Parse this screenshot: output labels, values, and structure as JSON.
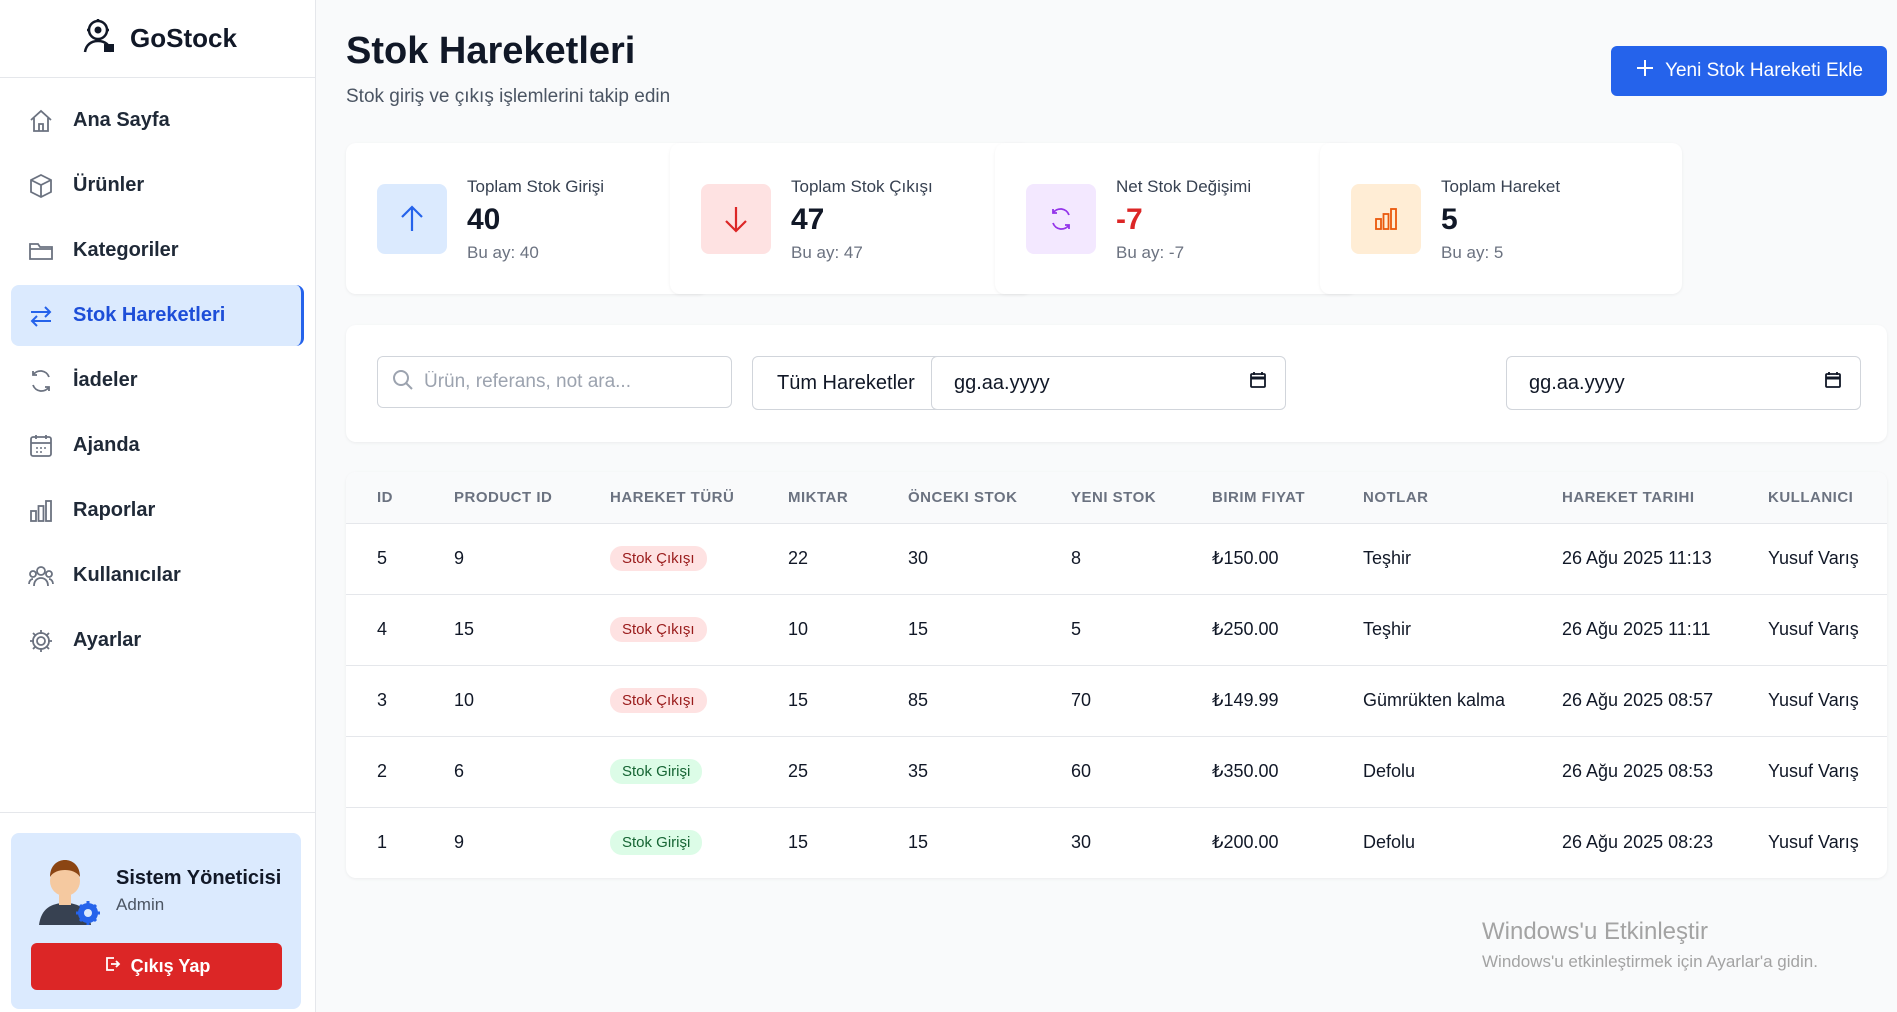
{
  "brand": {
    "name": "GoStock"
  },
  "sidebar": {
    "items": [
      {
        "label": "Ana Sayfa",
        "icon": "home-icon"
      },
      {
        "label": "Ürünler",
        "icon": "box-icon"
      },
      {
        "label": "Kategoriler",
        "icon": "folder-icon"
      },
      {
        "label": "Stok Hareketleri",
        "icon": "arrows-icon",
        "active": true
      },
      {
        "label": "İadeler",
        "icon": "refresh-icon"
      },
      {
        "label": "Ajanda",
        "icon": "calendar-icon"
      },
      {
        "label": "Raporlar",
        "icon": "bar-chart-icon"
      },
      {
        "label": "Kullanıcılar",
        "icon": "users-icon"
      },
      {
        "label": "Ayarlar",
        "icon": "gear-icon"
      }
    ]
  },
  "user": {
    "name": "Sistem Yöneticisi",
    "role": "Admin",
    "logout_label": "Çıkış Yap"
  },
  "header": {
    "title": "Stok Hareketleri",
    "subtitle": "Stok giriş ve çıkış işlemlerini takip edin",
    "add_button": "Yeni Stok Hareketi Ekle"
  },
  "stats": [
    {
      "label": "Toplam Stok Girişi",
      "value": "40",
      "sub": "Bu ay: 40",
      "icon": "arrow-up-icon",
      "color": "#2563eb",
      "bg": "#dbeafe",
      "value_color": "#111827"
    },
    {
      "label": "Toplam Stok Çıkışı",
      "value": "47",
      "sub": "Bu ay: 47",
      "icon": "arrow-down-icon",
      "color": "#dc2626",
      "bg": "#fee2e2",
      "value_color": "#111827"
    },
    {
      "label": "Net Stok Değişimi",
      "value": "-7",
      "sub": "Bu ay: -7",
      "icon": "refresh-icon",
      "color": "#9333ea",
      "bg": "#f3e8ff",
      "value_color": "#dc2626"
    },
    {
      "label": "Toplam Hareket",
      "value": "5",
      "sub": "Bu ay: 5",
      "icon": "bar-chart-icon",
      "color": "#ea580c",
      "bg": "#ffedd5",
      "value_color": "#111827"
    }
  ],
  "filters": {
    "search_placeholder": "Ürün, referans, not ara...",
    "type_selected": "Tüm Hareketler",
    "date_start_placeholder": "gg.aa.yyyy",
    "date_end_placeholder": "gg.aa.yyyy"
  },
  "table": {
    "headers": [
      "ID",
      "PRODUCT ID",
      "HAREKET TÜRÜ",
      "MIKTAR",
      "ÖNCEKI STOK",
      "YENI STOK",
      "BIRIM FIYAT",
      "NOTLAR",
      "HAREKET TARIHI",
      "KULLANICI"
    ],
    "rows": [
      {
        "id": "5",
        "product_id": "9",
        "type": "Stok Çıkışı",
        "type_kind": "out",
        "qty": "22",
        "prev": "30",
        "new": "8",
        "price": "₺150.00",
        "notes": "Teşhir",
        "date": "26 Ağu 2025 11:13",
        "user": "Yusuf Varış"
      },
      {
        "id": "4",
        "product_id": "15",
        "type": "Stok Çıkışı",
        "type_kind": "out",
        "qty": "10",
        "prev": "15",
        "new": "5",
        "price": "₺250.00",
        "notes": "Teşhir",
        "date": "26 Ağu 2025 11:11",
        "user": "Yusuf Varış"
      },
      {
        "id": "3",
        "product_id": "10",
        "type": "Stok Çıkışı",
        "type_kind": "out",
        "qty": "15",
        "prev": "85",
        "new": "70",
        "price": "₺149.99",
        "notes": "Gümrükten kalma",
        "date": "26 Ağu 2025 08:57",
        "user": "Yusuf Varış"
      },
      {
        "id": "2",
        "product_id": "6",
        "type": "Stok Girişi",
        "type_kind": "in",
        "qty": "25",
        "prev": "35",
        "new": "60",
        "price": "₺350.00",
        "notes": "Defolu",
        "date": "26 Ağu 2025 08:53",
        "user": "Yusuf Varış"
      },
      {
        "id": "1",
        "product_id": "9",
        "type": "Stok Girişi",
        "type_kind": "in",
        "qty": "15",
        "prev": "15",
        "new": "30",
        "price": "₺200.00",
        "notes": "Defolu",
        "date": "26 Ağu 2025 08:23",
        "user": "Yusuf Varış"
      }
    ]
  },
  "watermark": {
    "title": "Windows'u Etkinleştir",
    "subtitle": "Windows'u etkinleştirmek için Ayarlar'a gidin."
  }
}
